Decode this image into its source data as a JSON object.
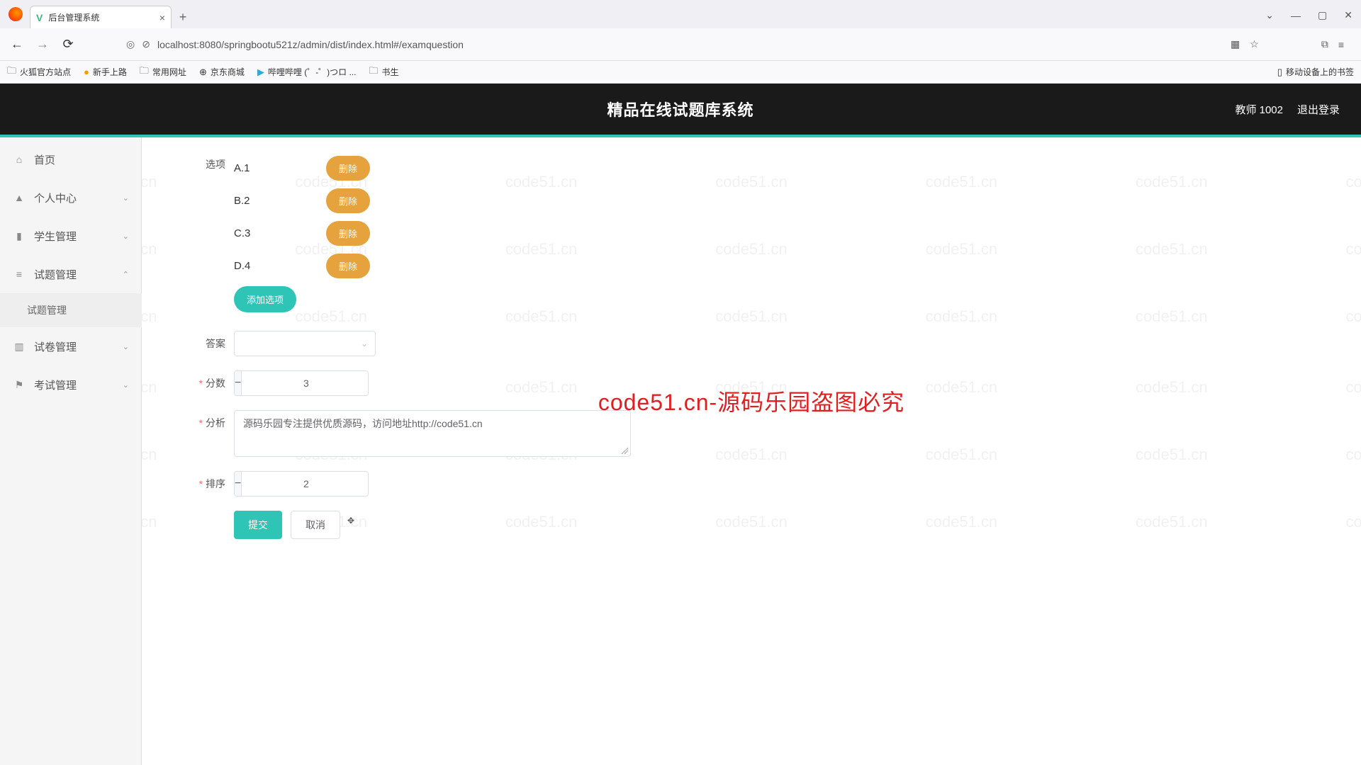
{
  "browser": {
    "tab_title": "后台管理系统",
    "url": "localhost:8080/springbootu521z/admin/dist/index.html#/examquestion",
    "bookmarks": [
      "火狐官方站点",
      "新手上路",
      "常用网址",
      "京东商城",
      "哔哩哔哩 (゜-゜)つロ ...",
      "书生"
    ],
    "bookmark_right": "移动设备上的书签"
  },
  "header": {
    "title": "精品在线试题库系统",
    "user": "教师 1002",
    "logout": "退出登录"
  },
  "sidebar": {
    "items": [
      {
        "label": "首页"
      },
      {
        "label": "个人中心"
      },
      {
        "label": "学生管理"
      },
      {
        "label": "试题管理"
      },
      {
        "label": "试卷管理"
      },
      {
        "label": "考试管理"
      }
    ],
    "sub": "试题管理"
  },
  "form": {
    "option_label": "选项",
    "options": [
      {
        "label": "A.1"
      },
      {
        "label": "B.2"
      },
      {
        "label": "C.3"
      },
      {
        "label": "D.4"
      }
    ],
    "delete_btn": "删除",
    "add_option": "添加选项",
    "answer_label": "答案",
    "score_label": "分数",
    "score_value": "3",
    "analysis_label": "分析",
    "analysis_value": "源码乐园专注提供优质源码，访问地址http://code51.cn",
    "order_label": "排序",
    "order_value": "2",
    "submit": "提交",
    "cancel": "取消"
  },
  "watermark": {
    "text": "code51.cn",
    "center": "code51.cn-源码乐园盗图必究"
  }
}
